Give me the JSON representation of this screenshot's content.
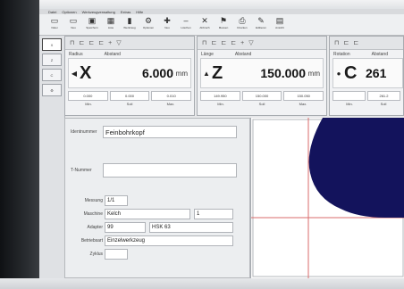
{
  "menu": [
    "Datei",
    "Optionen",
    "Werkzeugverwaltung",
    "Extras",
    "Hilfe"
  ],
  "toolbar": [
    {
      "icon": "doc-icon",
      "glyph": "▭",
      "label": "Datei"
    },
    {
      "icon": "doc-icon",
      "glyph": "▭",
      "label": "Neu"
    },
    {
      "icon": "save-icon",
      "glyph": "▣",
      "label": "Speichern"
    },
    {
      "icon": "table-icon",
      "glyph": "▦",
      "label": "Liste"
    },
    {
      "icon": "tool-icon",
      "glyph": "▮",
      "label": "Werkzeug"
    },
    {
      "icon": "gear-icon",
      "glyph": "⚙",
      "label": "Optionen"
    },
    {
      "icon": "plus-icon",
      "glyph": "✚",
      "label": "Neu"
    },
    {
      "icon": "minus-icon",
      "glyph": "–",
      "label": "Löschen"
    },
    {
      "icon": "x-icon",
      "glyph": "✕",
      "label": "Abbruch"
    },
    {
      "icon": "flag-icon",
      "glyph": "⚑",
      "label": "Messen"
    },
    {
      "icon": "print-icon",
      "glyph": "⎙",
      "label": "Drucken"
    },
    {
      "icon": "pencil-icon",
      "glyph": "✎",
      "label": "Editieren"
    },
    {
      "icon": "cube-icon",
      "glyph": "▤",
      "label": "Ansicht"
    }
  ],
  "sidebar": [
    {
      "label": "X"
    },
    {
      "label": "Z"
    },
    {
      "label": "C"
    },
    {
      "label": "⚙"
    }
  ],
  "axes": [
    {
      "col1": "Radius",
      "col2": "Abstand",
      "symbol": "◀",
      "name": "X",
      "value": "6.000",
      "unit": "mm",
      "tol": [
        "0.000",
        "0.000",
        "0.010"
      ],
      "caps": [
        "Min.",
        "Soll",
        "Max."
      ]
    },
    {
      "col1": "Länge",
      "col2": "Abstand",
      "symbol": "▲",
      "name": "Z",
      "value": "150.000",
      "unit": "mm",
      "tol": [
        "149.950",
        "150.000",
        "150.050"
      ],
      "caps": [
        "Min.",
        "Soll",
        "Max."
      ]
    },
    {
      "col1": "Rotation",
      "col2": "Abstand",
      "symbol": "●",
      "name": "C",
      "value": "261",
      "unit": "",
      "tol": [
        "",
        "261.2",
        ""
      ],
      "caps": [
        "Min.",
        "Soll",
        "Max."
      ]
    }
  ],
  "form": {
    "ident_label": "Identnummer",
    "ident_value": "Feinbohrkopf",
    "tnum_label": "T-Nummer",
    "tnum_value": "",
    "messung_label": "Messung",
    "messung_value": "1/1",
    "maschine_label": "Maschine",
    "maschine_value": "Kelch",
    "maschine_extra": "1",
    "adapter_label": "Adapter",
    "adapter_value": "99",
    "adapter_type": "HSK 63",
    "betrieb_label": "Betriebsart",
    "betrieb_value": "Einzelwerkzeug",
    "zyklus_label": "Zyklus",
    "zyklus_value": ""
  },
  "colors": {
    "tool_fill": "#13135c",
    "crosshair": "#d86b6b"
  }
}
